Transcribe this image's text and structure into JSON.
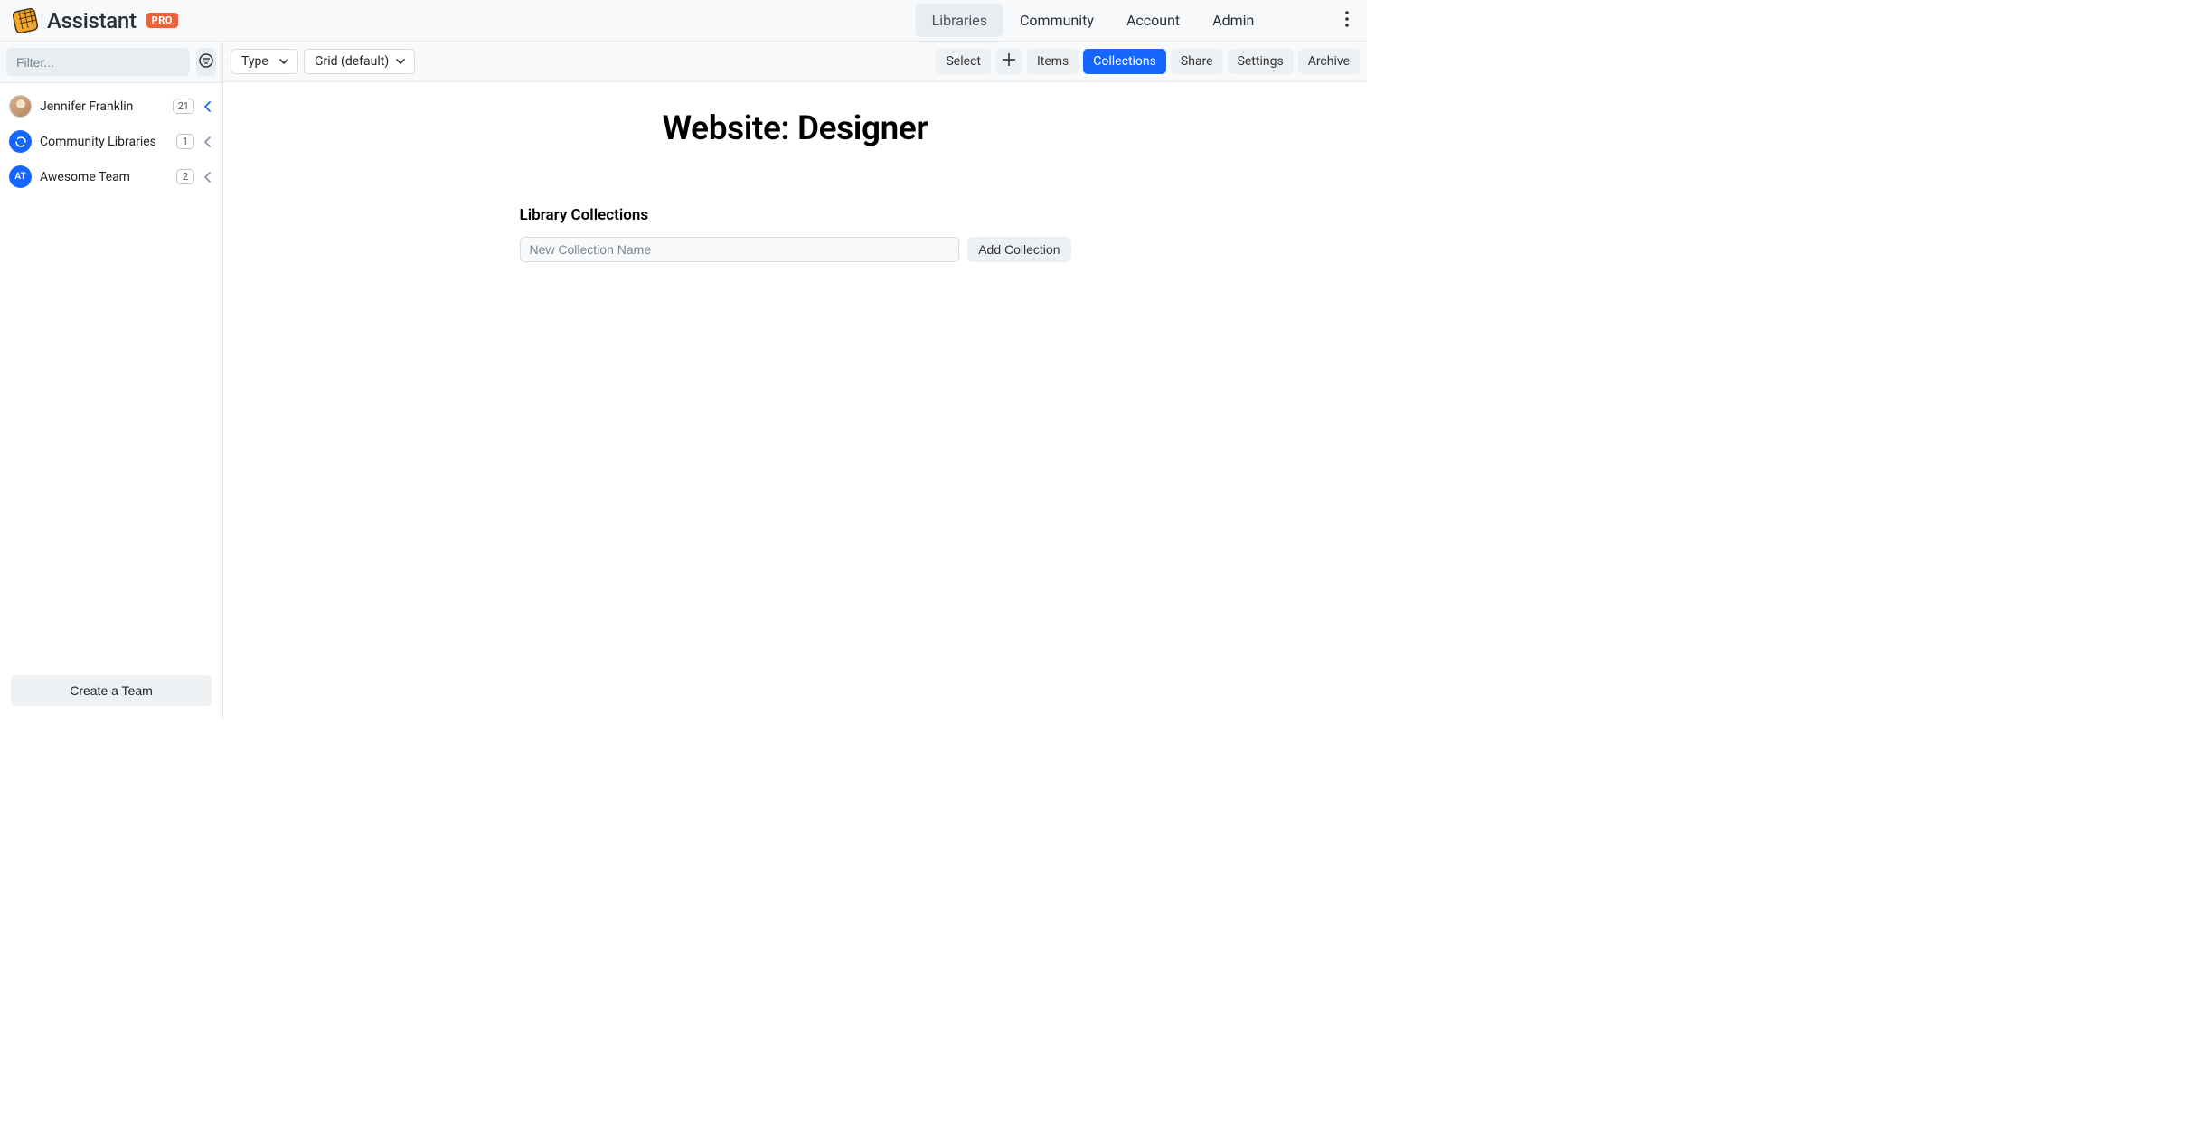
{
  "brand": {
    "name": "Assistant",
    "badge": "PRO"
  },
  "nav": {
    "items": [
      {
        "label": "Libraries",
        "active": true
      },
      {
        "label": "Community",
        "active": false
      },
      {
        "label": "Account",
        "active": false
      },
      {
        "label": "Admin",
        "active": false
      }
    ]
  },
  "sidebar": {
    "filter_placeholder": "Filter...",
    "items": [
      {
        "label": "Jennifer Franklin",
        "count": "21",
        "avatar_type": "photo",
        "avatar_text": "",
        "expanded": true
      },
      {
        "label": "Community Libraries",
        "count": "1",
        "avatar_type": "community",
        "avatar_text": "",
        "expanded": false
      },
      {
        "label": "Awesome Team",
        "count": "2",
        "avatar_type": "team",
        "avatar_text": "AT",
        "expanded": false
      }
    ],
    "create_team": "Create a Team"
  },
  "toolbar": {
    "type_label": "Type",
    "view_label": "Grid (default)",
    "chips": [
      {
        "label": "Select",
        "active": false
      },
      {
        "label": "Items",
        "active": false
      },
      {
        "label": "Collections",
        "active": true
      },
      {
        "label": "Share",
        "active": false
      },
      {
        "label": "Settings",
        "active": false
      },
      {
        "label": "Archive",
        "active": false
      }
    ]
  },
  "main": {
    "title": "Website: Designer",
    "section_title": "Library Collections",
    "new_collection_placeholder": "New Collection Name",
    "add_collection_label": "Add Collection"
  }
}
